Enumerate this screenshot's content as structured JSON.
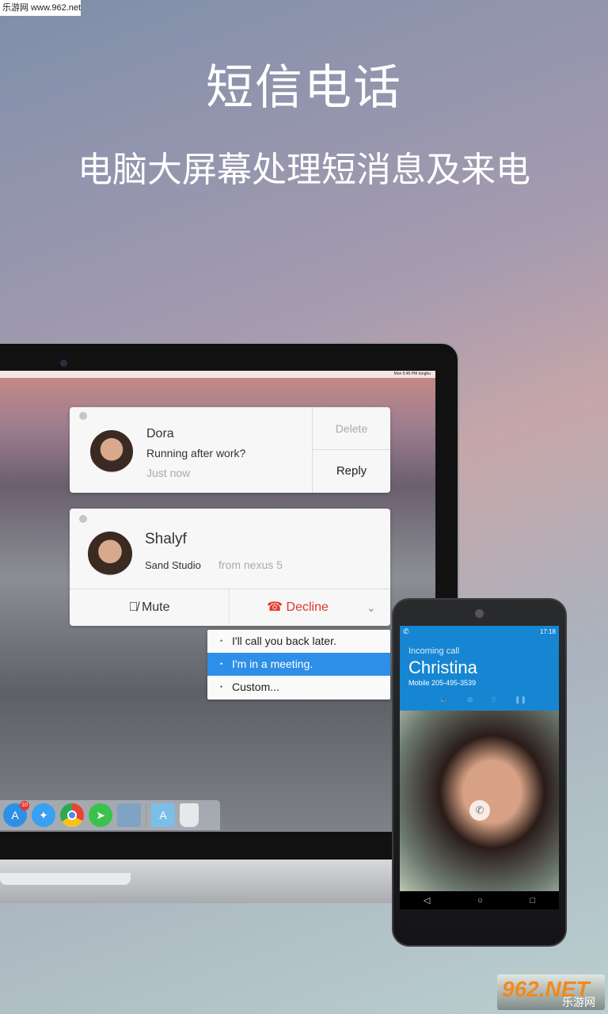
{
  "watermark": "乐游网 www.962.net",
  "title": "短信电话",
  "subtitle": "电脑大屏幕处理短消息及来电",
  "laptop": {
    "menubar": "Mon 5:45 PM   tongbu",
    "dock": {
      "badge": "10",
      "icons": [
        "app-store-icon",
        "safari-icon",
        "chrome-icon",
        "airdroid-icon",
        "preview-icon",
        "applications-folder-icon",
        "trash-icon"
      ]
    }
  },
  "notification_message": {
    "name": "Dora",
    "message": "Running after work?",
    "time": "Just now",
    "delete": "Delete",
    "reply": "Reply"
  },
  "notification_call": {
    "name": "Shalyf",
    "company": "Sand Studio",
    "source": "from  nexus 5",
    "mute": "Mute",
    "decline": "Decline",
    "decline_color": "#e0392b"
  },
  "quick_replies": {
    "items": [
      "I'll call you back later.",
      "I'm in a meeting.",
      "Custom..."
    ],
    "selected_index": 1,
    "highlight_color": "#2d8fe8"
  },
  "phone": {
    "time": "17:18",
    "label": "Incoming call",
    "caller": "Christina",
    "number": "Mobile 205-495-3539",
    "header_color": "#1686d3"
  },
  "logo": {
    "text": "962.NET",
    "sub": "乐游网"
  }
}
